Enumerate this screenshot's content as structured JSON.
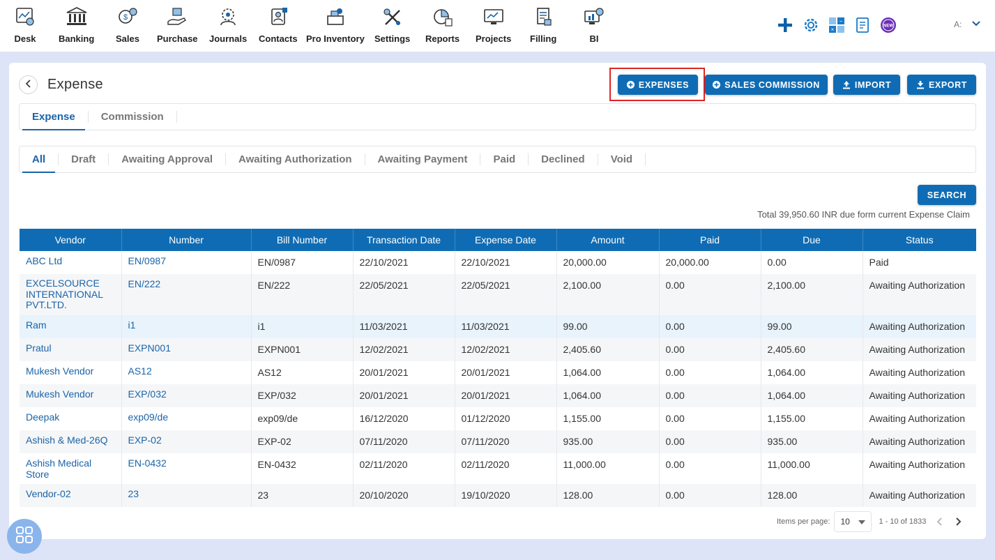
{
  "nav": {
    "items": [
      {
        "label": "Desk",
        "icon": "desk-icon"
      },
      {
        "label": "Banking",
        "icon": "bank-icon"
      },
      {
        "label": "Sales",
        "icon": "sales-icon"
      },
      {
        "label": "Purchase",
        "icon": "purchase-icon"
      },
      {
        "label": "Journals",
        "icon": "journals-icon"
      },
      {
        "label": "Contacts",
        "icon": "contacts-icon"
      },
      {
        "label": "Pro Inventory",
        "icon": "inventory-icon"
      },
      {
        "label": "Settings",
        "icon": "settings-tools-icon"
      },
      {
        "label": "Reports",
        "icon": "reports-icon"
      },
      {
        "label": "Projects",
        "icon": "projects-icon"
      },
      {
        "label": "Filling",
        "icon": "filling-icon"
      },
      {
        "label": "BI",
        "icon": "bi-icon"
      }
    ],
    "right_icons": [
      "plus-icon",
      "gear-icon",
      "calculator-icon",
      "notes-icon",
      "new-badge-icon"
    ],
    "new_badge": "NEW",
    "user_initial": "A:"
  },
  "page": {
    "title": "Expense",
    "buttons": {
      "expenses": "EXPENSES",
      "sales_commission": "SALES COMMISSION",
      "import": "IMPORT",
      "export": "EXPORT",
      "search": "SEARCH"
    },
    "main_tabs": [
      "Expense",
      "Commission"
    ],
    "status_tabs": [
      "All",
      "Draft",
      "Awaiting Approval",
      "Awaiting Authorization",
      "Awaiting Payment",
      "Paid",
      "Declined",
      "Void"
    ],
    "total_text": "Total 39,950.60 INR due form current Expense Claim"
  },
  "table": {
    "columns": [
      "Vendor",
      "Number",
      "Bill Number",
      "Transaction Date",
      "Expense Date",
      "Amount",
      "Paid",
      "Due",
      "Status"
    ],
    "rows": [
      {
        "vendor": "ABC Ltd",
        "number": "EN/0987",
        "bill": "EN/0987",
        "tdate": "22/10/2021",
        "edate": "22/10/2021",
        "amount": "20,000.00",
        "paid": "20,000.00",
        "due": "0.00",
        "status": "Paid"
      },
      {
        "vendor": "EXCELSOURCE INTERNATIONAL PVT.LTD.",
        "number": "EN/222",
        "bill": "EN/222",
        "tdate": "22/05/2021",
        "edate": "22/05/2021",
        "amount": "2,100.00",
        "paid": "0.00",
        "due": "2,100.00",
        "status": "Awaiting Authorization"
      },
      {
        "vendor": "Ram",
        "number": "i1",
        "bill": "i1",
        "tdate": "11/03/2021",
        "edate": "11/03/2021",
        "amount": "99.00",
        "paid": "0.00",
        "due": "99.00",
        "status": "Awaiting Authorization"
      },
      {
        "vendor": "Pratul",
        "number": "EXPN001",
        "bill": "EXPN001",
        "tdate": "12/02/2021",
        "edate": "12/02/2021",
        "amount": "2,405.60",
        "paid": "0.00",
        "due": "2,405.60",
        "status": "Awaiting Authorization"
      },
      {
        "vendor": "Mukesh Vendor",
        "number": "AS12",
        "bill": "AS12",
        "tdate": "20/01/2021",
        "edate": "20/01/2021",
        "amount": "1,064.00",
        "paid": "0.00",
        "due": "1,064.00",
        "status": "Awaiting Authorization"
      },
      {
        "vendor": "Mukesh Vendor",
        "number": "EXP/032",
        "bill": "EXP/032",
        "tdate": "20/01/2021",
        "edate": "20/01/2021",
        "amount": "1,064.00",
        "paid": "0.00",
        "due": "1,064.00",
        "status": "Awaiting Authorization"
      },
      {
        "vendor": "Deepak",
        "number": "exp09/de",
        "bill": "exp09/de",
        "tdate": "16/12/2020",
        "edate": "01/12/2020",
        "amount": "1,155.00",
        "paid": "0.00",
        "due": "1,155.00",
        "status": "Awaiting Authorization"
      },
      {
        "vendor": "Ashish & Med-26Q",
        "number": "EXP-02",
        "bill": "EXP-02",
        "tdate": "07/11/2020",
        "edate": "07/11/2020",
        "amount": "935.00",
        "paid": "0.00",
        "due": "935.00",
        "status": "Awaiting Authorization"
      },
      {
        "vendor": "Ashish Medical Store",
        "number": "EN-0432",
        "bill": "EN-0432",
        "tdate": "02/11/2020",
        "edate": "02/11/2020",
        "amount": "11,000.00",
        "paid": "0.00",
        "due": "11,000.00",
        "status": "Awaiting Authorization"
      },
      {
        "vendor": "Vendor-02",
        "number": "23",
        "bill": "23",
        "tdate": "20/10/2020",
        "edate": "19/10/2020",
        "amount": "128.00",
        "paid": "0.00",
        "due": "128.00",
        "status": "Awaiting Authorization"
      }
    ]
  },
  "pagination": {
    "items_per_page_label": "Items per page:",
    "items_per_page": "10",
    "range": "1 - 10 of 1833"
  },
  "colors": {
    "primary": "#0f6cb4",
    "link": "#1a64a8",
    "highlight": "#e02424",
    "background": "#dde4f7"
  }
}
